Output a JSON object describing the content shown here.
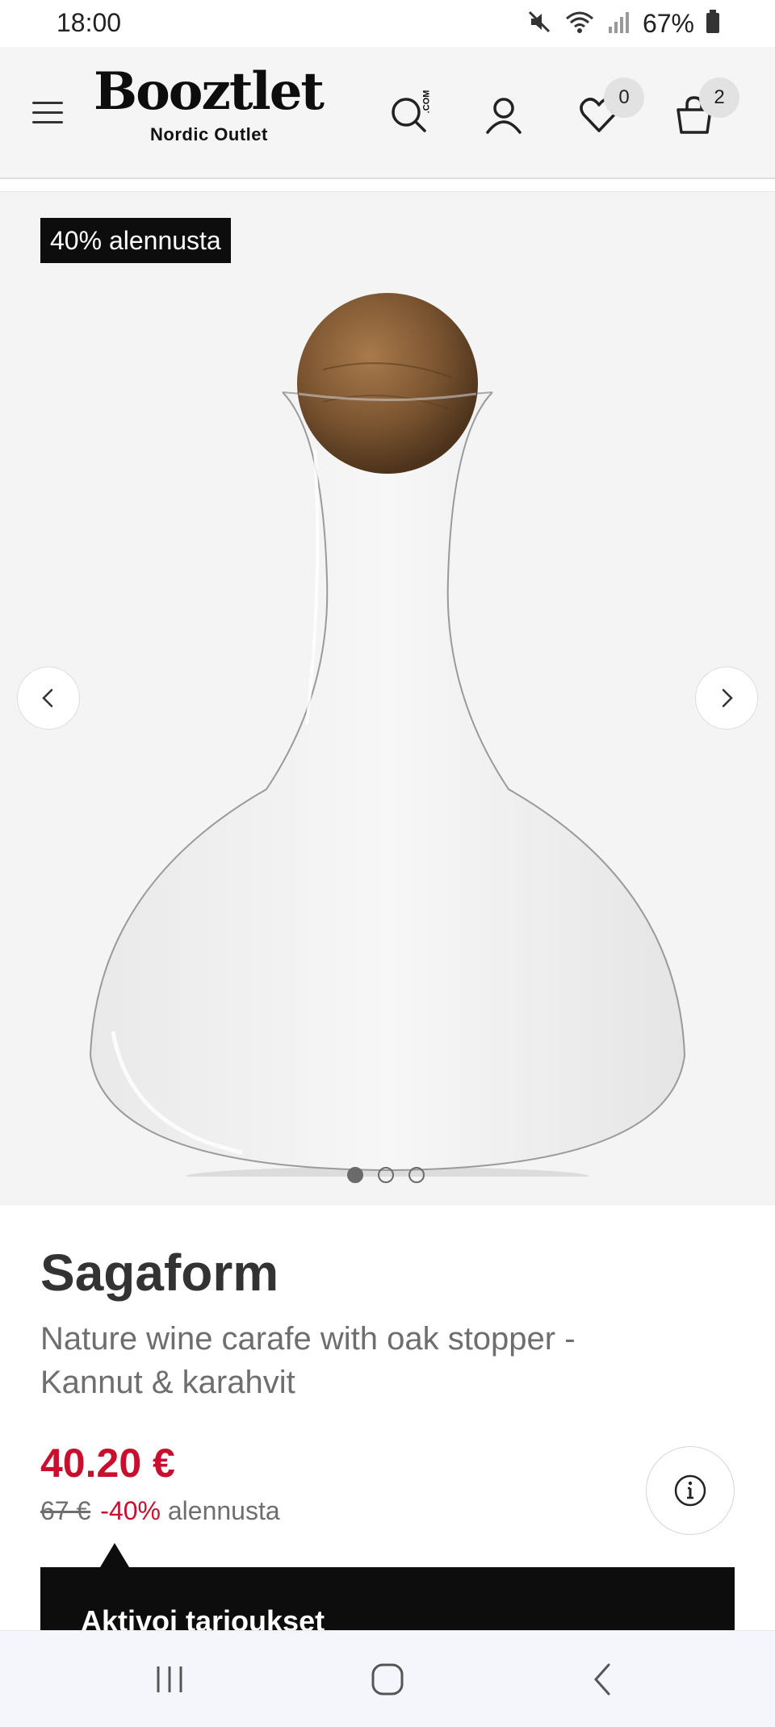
{
  "status_bar": {
    "time": "18:00",
    "battery_text": "67%",
    "icons": [
      "mute-icon",
      "wifi-icon",
      "signal-icon",
      "battery-icon"
    ]
  },
  "header": {
    "logo_text": "Booztlet",
    "logo_suffix": ".COM",
    "logo_subtitle": "Nordic Outlet",
    "wishlist_count": "0",
    "cart_count": "2",
    "icons": [
      "menu-icon",
      "search-icon",
      "account-icon",
      "heart-icon",
      "bag-icon"
    ]
  },
  "gallery": {
    "discount_badge": "40% alennusta",
    "slide_count": 3,
    "active_slide": 1
  },
  "product": {
    "brand": "Sagaform",
    "name": "Nature wine carafe with oak stopper - Kannut & karahvit",
    "price": "40.20 €",
    "old_price": "67 €",
    "discount_pct": "-40%",
    "discount_word": "alennusta"
  },
  "offers": {
    "label": "Aktivoi tarjoukset"
  },
  "colors": {
    "sale_red": "#c8102e",
    "black": "#0d0d0d",
    "gray_text": "#6e6e6e"
  }
}
